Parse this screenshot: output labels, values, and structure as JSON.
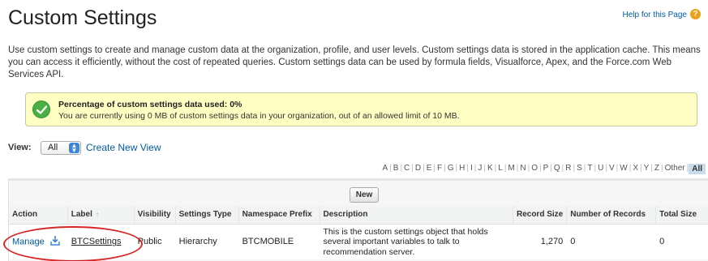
{
  "header": {
    "title": "Custom Settings",
    "help_link": "Help for this Page",
    "help_icon": "help-icon"
  },
  "intro": "Use custom settings to create and manage custom data at the organization, profile, and user levels. Custom settings data is stored in the application cache. This means you can access it efficiently, without the cost of repeated queries. Custom settings data can be used by formula fields, Visualforce, Apex, and the Force.com Web Services API.",
  "usage": {
    "icon": "success-check-icon",
    "title": "Percentage of custom settings data used: 0%",
    "detail": "You are currently using 0 MB of custom settings data in your organization, out of an allowed limit of 10 MB."
  },
  "view": {
    "label": "View:",
    "selected": "All",
    "create_link": "Create New View"
  },
  "alphabet": [
    "A",
    "B",
    "C",
    "D",
    "E",
    "F",
    "G",
    "H",
    "I",
    "J",
    "K",
    "L",
    "M",
    "N",
    "O",
    "P",
    "Q",
    "R",
    "S",
    "T",
    "U",
    "V",
    "W",
    "X",
    "Y",
    "Z",
    "Other",
    "All"
  ],
  "list": {
    "new_button": "New",
    "columns": [
      "Action",
      "Label",
      "Visibility",
      "Settings Type",
      "Namespace Prefix",
      "Description",
      "Record Size",
      "Number of Records",
      "Total Size"
    ],
    "rows": [
      {
        "action": "Manage",
        "label": "BTCSettings",
        "visibility": "Public",
        "settings_type": "Hierarchy",
        "namespace_prefix": "BTCMOBILE",
        "description": "This is the custom settings object that holds several important variables to talk to recommendation server.",
        "record_size": "1,270",
        "number_of_records": "0",
        "total_size": "0"
      }
    ]
  },
  "colors": {
    "link": "#015ba7",
    "usage_bg": "#ffffc3",
    "success": "#4bb043",
    "highlight": "#d62626"
  }
}
